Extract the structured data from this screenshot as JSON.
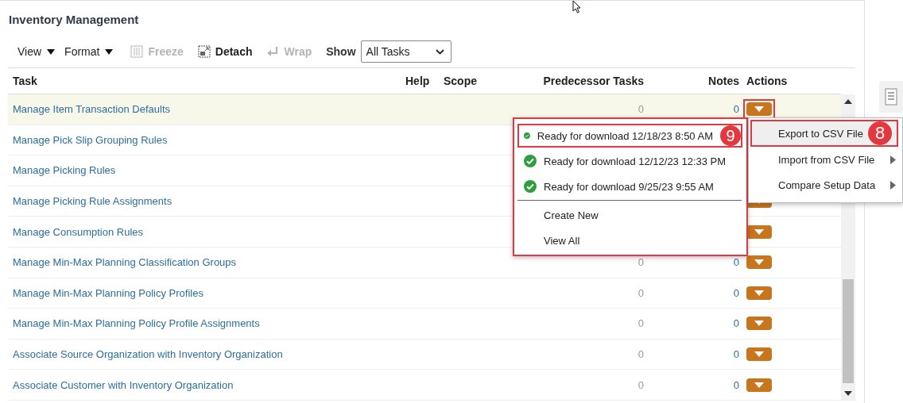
{
  "title": "Inventory Management",
  "toolbar": {
    "menus": [
      {
        "label": "View"
      },
      {
        "label": "Format"
      }
    ],
    "buttons": [
      {
        "label": "Freeze",
        "disabled": true,
        "kind": "freeze"
      },
      {
        "label": "Detach",
        "disabled": false,
        "kind": "detach"
      },
      {
        "label": "Wrap",
        "disabled": true,
        "kind": "wrap"
      }
    ],
    "show": {
      "label": "Show",
      "value": "All Tasks"
    }
  },
  "table": {
    "columns": [
      "Task",
      "Help",
      "Scope",
      "Predecessor Tasks",
      "Notes",
      "Actions"
    ],
    "rows": [
      {
        "task": "Manage Item Transaction Defaults",
        "selected": true,
        "predecessor_tasks": "0",
        "notes": "0",
        "actions_button": {
          "annotated": true
        }
      },
      {
        "task": "Manage Pick Slip Grouping Rules",
        "selected": false
      },
      {
        "task": "Manage Picking Rules",
        "selected": false
      },
      {
        "task": "Manage Picking Rule Assignments",
        "selected": false,
        "actions_button": {
          "annotated": false
        }
      },
      {
        "task": "Manage Consumption Rules",
        "selected": false,
        "actions_button": {
          "annotated": false
        }
      },
      {
        "task": "Manage Min-Max Planning Classification Groups",
        "selected": false,
        "predecessor_tasks": "0",
        "notes": "0",
        "actions_button": {
          "annotated": false
        }
      },
      {
        "task": "Manage Min-Max Planning Policy Profiles",
        "selected": false,
        "predecessor_tasks": "0",
        "notes": "0",
        "actions_button": {
          "annotated": false
        }
      },
      {
        "task": "Manage Min-Max Planning Policy Profile Assignments",
        "selected": false,
        "predecessor_tasks": "0",
        "notes": "0",
        "actions_button": {
          "annotated": false
        }
      },
      {
        "task": "Associate Source Organization with Inventory Organization",
        "selected": false,
        "predecessor_tasks": "0",
        "notes": "0",
        "actions_button": {
          "annotated": false
        }
      },
      {
        "task": "Associate Customer with Inventory Organization",
        "selected": false,
        "predecessor_tasks": "0",
        "notes": "0",
        "actions_button": {
          "annotated": false
        }
      }
    ]
  },
  "actions_menu": {
    "items": [
      {
        "label": "Export to CSV File",
        "submenu": false,
        "selected": true,
        "annotated": true,
        "callout": "8"
      },
      {
        "label": "Import from CSV File",
        "submenu": true,
        "selected": false,
        "annotated": false
      },
      {
        "label": "Compare Setup Data",
        "submenu": true,
        "selected": false,
        "annotated": false
      }
    ]
  },
  "export_menu": {
    "items": [
      {
        "label": "Ready for download 12/18/23 8:50 AM",
        "kind": "download",
        "annotated": true,
        "callout": "9"
      },
      {
        "label": "Ready for download 12/12/23 12:33 PM",
        "kind": "download",
        "annotated": false
      },
      {
        "label": "Ready for download 9/25/23 9:55 AM",
        "kind": "download",
        "annotated": false
      },
      {
        "label": "Create New",
        "kind": "action",
        "annotated": false
      },
      {
        "label": "View All",
        "kind": "action",
        "annotated": false
      }
    ]
  }
}
